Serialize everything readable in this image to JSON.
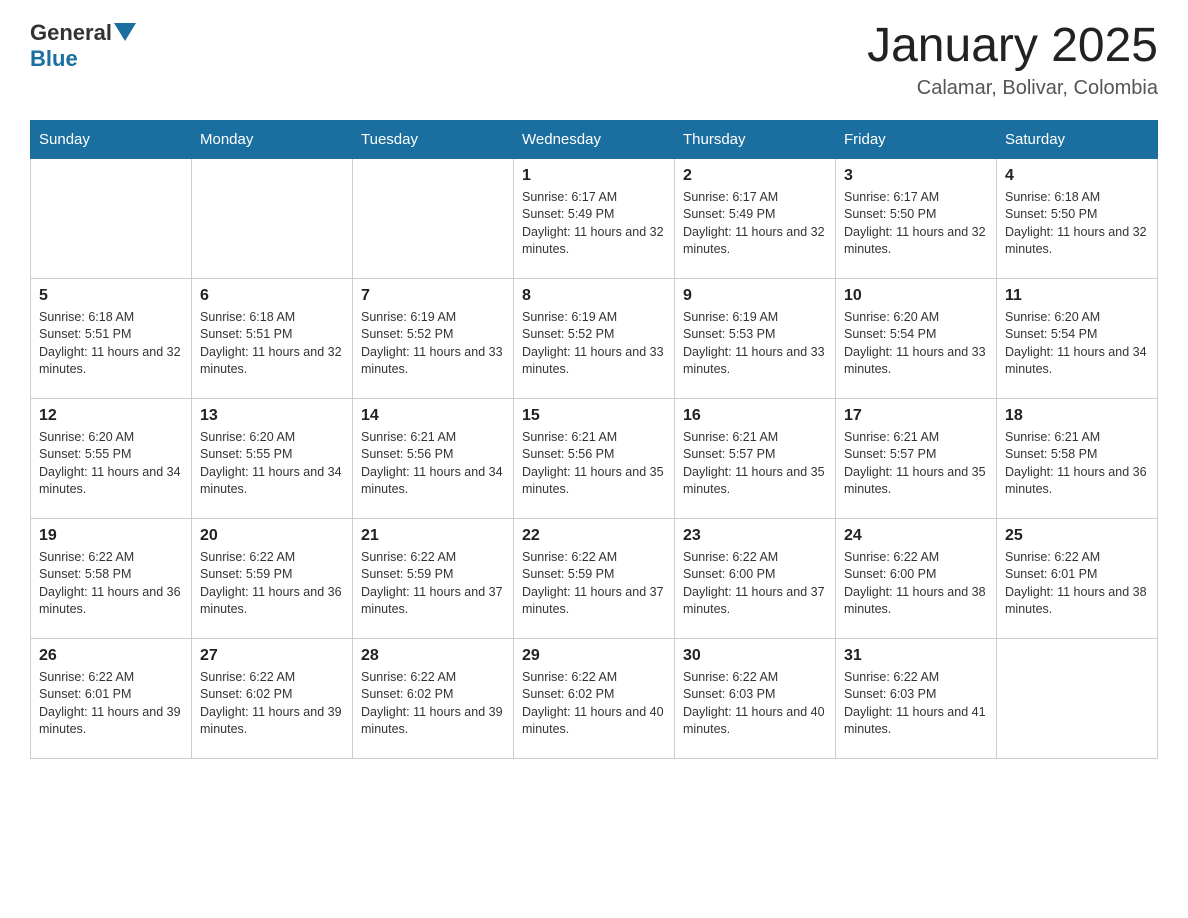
{
  "header": {
    "logo": {
      "general": "General",
      "blue": "Blue"
    },
    "title": "January 2025",
    "location": "Calamar, Bolivar, Colombia"
  },
  "calendar": {
    "days_of_week": [
      "Sunday",
      "Monday",
      "Tuesday",
      "Wednesday",
      "Thursday",
      "Friday",
      "Saturday"
    ],
    "weeks": [
      [
        {
          "day": "",
          "info": ""
        },
        {
          "day": "",
          "info": ""
        },
        {
          "day": "",
          "info": ""
        },
        {
          "day": "1",
          "info": "Sunrise: 6:17 AM\nSunset: 5:49 PM\nDaylight: 11 hours and 32 minutes."
        },
        {
          "day": "2",
          "info": "Sunrise: 6:17 AM\nSunset: 5:49 PM\nDaylight: 11 hours and 32 minutes."
        },
        {
          "day": "3",
          "info": "Sunrise: 6:17 AM\nSunset: 5:50 PM\nDaylight: 11 hours and 32 minutes."
        },
        {
          "day": "4",
          "info": "Sunrise: 6:18 AM\nSunset: 5:50 PM\nDaylight: 11 hours and 32 minutes."
        }
      ],
      [
        {
          "day": "5",
          "info": "Sunrise: 6:18 AM\nSunset: 5:51 PM\nDaylight: 11 hours and 32 minutes."
        },
        {
          "day": "6",
          "info": "Sunrise: 6:18 AM\nSunset: 5:51 PM\nDaylight: 11 hours and 32 minutes."
        },
        {
          "day": "7",
          "info": "Sunrise: 6:19 AM\nSunset: 5:52 PM\nDaylight: 11 hours and 33 minutes."
        },
        {
          "day": "8",
          "info": "Sunrise: 6:19 AM\nSunset: 5:52 PM\nDaylight: 11 hours and 33 minutes."
        },
        {
          "day": "9",
          "info": "Sunrise: 6:19 AM\nSunset: 5:53 PM\nDaylight: 11 hours and 33 minutes."
        },
        {
          "day": "10",
          "info": "Sunrise: 6:20 AM\nSunset: 5:54 PM\nDaylight: 11 hours and 33 minutes."
        },
        {
          "day": "11",
          "info": "Sunrise: 6:20 AM\nSunset: 5:54 PM\nDaylight: 11 hours and 34 minutes."
        }
      ],
      [
        {
          "day": "12",
          "info": "Sunrise: 6:20 AM\nSunset: 5:55 PM\nDaylight: 11 hours and 34 minutes."
        },
        {
          "day": "13",
          "info": "Sunrise: 6:20 AM\nSunset: 5:55 PM\nDaylight: 11 hours and 34 minutes."
        },
        {
          "day": "14",
          "info": "Sunrise: 6:21 AM\nSunset: 5:56 PM\nDaylight: 11 hours and 34 minutes."
        },
        {
          "day": "15",
          "info": "Sunrise: 6:21 AM\nSunset: 5:56 PM\nDaylight: 11 hours and 35 minutes."
        },
        {
          "day": "16",
          "info": "Sunrise: 6:21 AM\nSunset: 5:57 PM\nDaylight: 11 hours and 35 minutes."
        },
        {
          "day": "17",
          "info": "Sunrise: 6:21 AM\nSunset: 5:57 PM\nDaylight: 11 hours and 35 minutes."
        },
        {
          "day": "18",
          "info": "Sunrise: 6:21 AM\nSunset: 5:58 PM\nDaylight: 11 hours and 36 minutes."
        }
      ],
      [
        {
          "day": "19",
          "info": "Sunrise: 6:22 AM\nSunset: 5:58 PM\nDaylight: 11 hours and 36 minutes."
        },
        {
          "day": "20",
          "info": "Sunrise: 6:22 AM\nSunset: 5:59 PM\nDaylight: 11 hours and 36 minutes."
        },
        {
          "day": "21",
          "info": "Sunrise: 6:22 AM\nSunset: 5:59 PM\nDaylight: 11 hours and 37 minutes."
        },
        {
          "day": "22",
          "info": "Sunrise: 6:22 AM\nSunset: 5:59 PM\nDaylight: 11 hours and 37 minutes."
        },
        {
          "day": "23",
          "info": "Sunrise: 6:22 AM\nSunset: 6:00 PM\nDaylight: 11 hours and 37 minutes."
        },
        {
          "day": "24",
          "info": "Sunrise: 6:22 AM\nSunset: 6:00 PM\nDaylight: 11 hours and 38 minutes."
        },
        {
          "day": "25",
          "info": "Sunrise: 6:22 AM\nSunset: 6:01 PM\nDaylight: 11 hours and 38 minutes."
        }
      ],
      [
        {
          "day": "26",
          "info": "Sunrise: 6:22 AM\nSunset: 6:01 PM\nDaylight: 11 hours and 39 minutes."
        },
        {
          "day": "27",
          "info": "Sunrise: 6:22 AM\nSunset: 6:02 PM\nDaylight: 11 hours and 39 minutes."
        },
        {
          "day": "28",
          "info": "Sunrise: 6:22 AM\nSunset: 6:02 PM\nDaylight: 11 hours and 39 minutes."
        },
        {
          "day": "29",
          "info": "Sunrise: 6:22 AM\nSunset: 6:02 PM\nDaylight: 11 hours and 40 minutes."
        },
        {
          "day": "30",
          "info": "Sunrise: 6:22 AM\nSunset: 6:03 PM\nDaylight: 11 hours and 40 minutes."
        },
        {
          "day": "31",
          "info": "Sunrise: 6:22 AM\nSunset: 6:03 PM\nDaylight: 11 hours and 41 minutes."
        },
        {
          "day": "",
          "info": ""
        }
      ]
    ]
  }
}
